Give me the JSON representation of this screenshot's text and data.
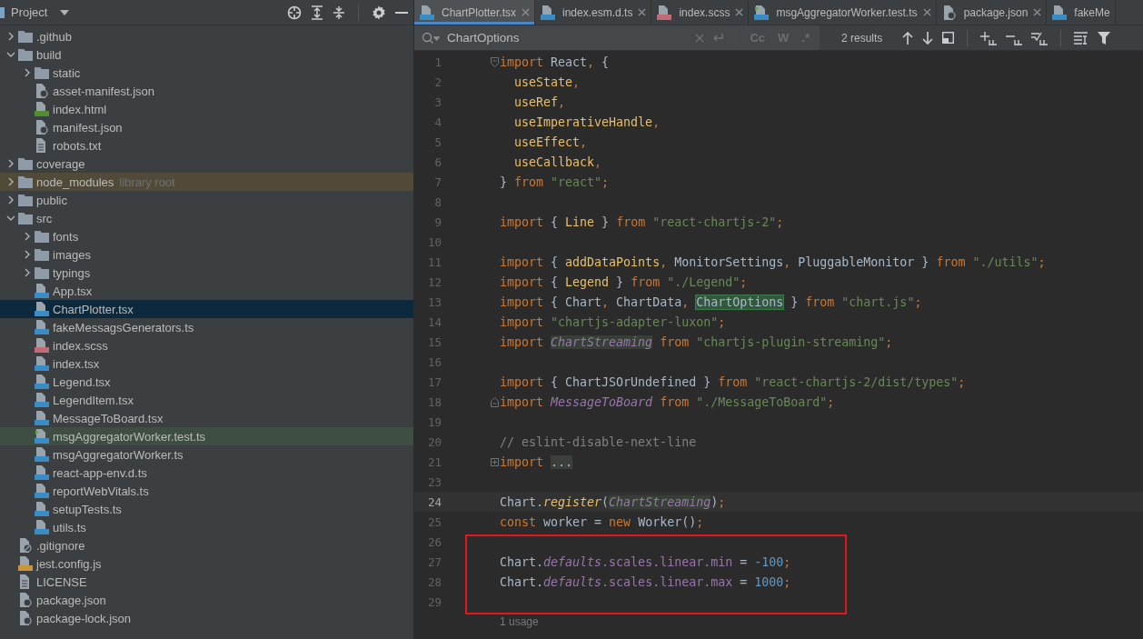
{
  "project_panel": {
    "title": "Project",
    "tree": [
      {
        "kind": "folder",
        "name": ".github",
        "expanded": false,
        "selected": false,
        "highlighted": false
      },
      {
        "kind": "folder",
        "name": "build",
        "expanded": true,
        "selected": false,
        "highlighted": false,
        "children": [
          {
            "kind": "folder",
            "name": "static",
            "expanded": false,
            "selected": false,
            "highlighted": false
          },
          {
            "kind": "json",
            "name": "asset-manifest.json",
            "selected": false,
            "highlighted": false
          },
          {
            "kind": "html",
            "name": "index.html",
            "selected": false,
            "highlighted": false
          },
          {
            "kind": "json",
            "name": "manifest.json",
            "selected": false,
            "highlighted": false
          },
          {
            "kind": "text",
            "name": "robots.txt",
            "selected": false,
            "highlighted": false
          }
        ]
      },
      {
        "kind": "folder",
        "name": "coverage",
        "expanded": false,
        "selected": false,
        "highlighted": false
      },
      {
        "kind": "folder",
        "name": "node_modules",
        "note": "library root",
        "expanded": false,
        "selected": false,
        "highlighted": false
      },
      {
        "kind": "folder",
        "name": "public",
        "expanded": false,
        "selected": false,
        "highlighted": false
      },
      {
        "kind": "folder",
        "name": "src",
        "expanded": true,
        "selected": false,
        "highlighted": false,
        "children": [
          {
            "kind": "folder",
            "name": "fonts",
            "expanded": false,
            "selected": false,
            "highlighted": false
          },
          {
            "kind": "folder",
            "name": "images",
            "expanded": false,
            "selected": false,
            "highlighted": false
          },
          {
            "kind": "folder",
            "name": "typings",
            "expanded": false,
            "selected": false,
            "highlighted": false
          },
          {
            "kind": "tsx",
            "name": "App.tsx",
            "selected": false,
            "highlighted": false
          },
          {
            "kind": "tsx",
            "name": "ChartPlotter.tsx",
            "selected": true,
            "highlighted": false
          },
          {
            "kind": "ts",
            "name": "fakeMessagsGenerators.ts",
            "selected": false,
            "highlighted": false
          },
          {
            "kind": "sass",
            "name": "index.scss",
            "selected": false,
            "highlighted": false
          },
          {
            "kind": "tsx",
            "name": "index.tsx",
            "selected": false,
            "highlighted": false
          },
          {
            "kind": "tsx",
            "name": "Legend.tsx",
            "selected": false,
            "highlighted": false
          },
          {
            "kind": "tsx",
            "name": "LegendItem.tsx",
            "selected": false,
            "highlighted": false
          },
          {
            "kind": "tsx",
            "name": "MessageToBoard.tsx",
            "selected": false,
            "highlighted": false
          },
          {
            "kind": "test",
            "name": "msgAggregatorWorker.test.ts",
            "selected": false,
            "highlighted": true
          },
          {
            "kind": "ts",
            "name": "msgAggregatorWorker.ts",
            "selected": false,
            "highlighted": false
          },
          {
            "kind": "ts",
            "name": "react-app-env.d.ts",
            "selected": false,
            "highlighted": false
          },
          {
            "kind": "ts",
            "name": "reportWebVitals.ts",
            "selected": false,
            "highlighted": false
          },
          {
            "kind": "ts",
            "name": "setupTests.ts",
            "selected": false,
            "highlighted": false
          },
          {
            "kind": "ts",
            "name": "utils.ts",
            "selected": false,
            "highlighted": false
          }
        ]
      },
      {
        "kind": "ignore",
        "name": ".gitignore",
        "selected": false,
        "highlighted": false
      },
      {
        "kind": "js",
        "name": "jest.config.js",
        "selected": false,
        "highlighted": false
      },
      {
        "kind": "text",
        "name": "LICENSE",
        "selected": false,
        "highlighted": false
      },
      {
        "kind": "json",
        "name": "package.json",
        "selected": false,
        "highlighted": false
      },
      {
        "kind": "json",
        "name": "package-lock.json",
        "selected": false,
        "highlighted": false
      }
    ]
  },
  "editor": {
    "tabs": [
      {
        "label": "ChartPlotter.tsx",
        "kind": "tsx",
        "selected": true,
        "closable": true
      },
      {
        "label": "index.esm.d.ts",
        "kind": "ts",
        "selected": false,
        "closable": true
      },
      {
        "label": "index.scss",
        "kind": "sass",
        "selected": false,
        "closable": true
      },
      {
        "label": "msgAggregatorWorker.test.ts",
        "kind": "test",
        "selected": false,
        "closable": true
      },
      {
        "label": "package.json",
        "kind": "json",
        "selected": false,
        "closable": true
      },
      {
        "label": "fakeMe",
        "kind": "ts",
        "selected": false,
        "closable": false
      }
    ],
    "search": {
      "value": "ChartOptions",
      "options": [
        "Cc",
        "W",
        ".*"
      ],
      "result_count": "2 results"
    },
    "lines": [
      {
        "number": "1",
        "kind": "fold-start",
        "current": false,
        "boxed": false,
        "tokens": [
          {
            "kind": "kw",
            "text": "import "
          },
          {
            "kind": "plain",
            "text": "React"
          },
          {
            "kind": "kw",
            "text": ", "
          },
          {
            "kind": "plain",
            "text": "{"
          }
        ]
      },
      {
        "number": "2",
        "current": false,
        "boxed": false,
        "tokens": [
          {
            "kind": "fn",
            "text": "  useState"
          },
          {
            "kind": "kw",
            "text": ","
          }
        ]
      },
      {
        "number": "3",
        "current": false,
        "boxed": false,
        "tokens": [
          {
            "kind": "fn",
            "text": "  useRef"
          },
          {
            "kind": "kw",
            "text": ","
          }
        ]
      },
      {
        "number": "4",
        "current": false,
        "boxed": false,
        "tokens": [
          {
            "kind": "fn",
            "text": "  useImperativeHandle"
          },
          {
            "kind": "kw",
            "text": ","
          }
        ]
      },
      {
        "number": "5",
        "current": false,
        "boxed": false,
        "tokens": [
          {
            "kind": "fn",
            "text": "  useEffect"
          },
          {
            "kind": "kw",
            "text": ","
          }
        ]
      },
      {
        "number": "6",
        "current": false,
        "boxed": false,
        "tokens": [
          {
            "kind": "fn",
            "text": "  useCallback"
          },
          {
            "kind": "kw",
            "text": ","
          }
        ]
      },
      {
        "number": "7",
        "current": false,
        "boxed": false,
        "tokens": [
          {
            "kind": "plain",
            "text": "} "
          },
          {
            "kind": "kw",
            "text": "from "
          },
          {
            "kind": "str",
            "text": "\"react\""
          },
          {
            "kind": "kw",
            "text": ";"
          }
        ]
      },
      {
        "number": "8",
        "current": false,
        "boxed": false
      },
      {
        "number": "9",
        "current": false,
        "boxed": false,
        "tokens": [
          {
            "kind": "kw",
            "text": "import "
          },
          {
            "kind": "plain",
            "text": "{ "
          },
          {
            "kind": "fn",
            "text": "Line"
          },
          {
            "kind": "plain",
            "text": " } "
          },
          {
            "kind": "kw",
            "text": "from "
          },
          {
            "kind": "str",
            "text": "\"react-chartjs-2\""
          },
          {
            "kind": "kw",
            "text": ";"
          }
        ]
      },
      {
        "number": "10",
        "current": false,
        "boxed": false
      },
      {
        "number": "11",
        "current": false,
        "boxed": false,
        "tokens": [
          {
            "kind": "kw",
            "text": "import "
          },
          {
            "kind": "plain",
            "text": "{ "
          },
          {
            "kind": "fn",
            "text": "addDataPoints"
          },
          {
            "kind": "kw",
            "text": ", "
          },
          {
            "kind": "plain",
            "text": "MonitorSettings"
          },
          {
            "kind": "kw",
            "text": ", "
          },
          {
            "kind": "plain",
            "text": "PluggableMonitor } "
          },
          {
            "kind": "kw",
            "text": "from "
          },
          {
            "kind": "str",
            "text": "\"./utils\""
          },
          {
            "kind": "kw",
            "text": ";"
          }
        ]
      },
      {
        "number": "12",
        "current": false,
        "boxed": false,
        "tokens": [
          {
            "kind": "kw",
            "text": "import "
          },
          {
            "kind": "plain",
            "text": "{ "
          },
          {
            "kind": "fn",
            "text": "Legend"
          },
          {
            "kind": "plain",
            "text": " } "
          },
          {
            "kind": "kw",
            "text": "from "
          },
          {
            "kind": "str",
            "text": "\"./Legend\""
          },
          {
            "kind": "kw",
            "text": ";"
          }
        ]
      },
      {
        "number": "13",
        "current": false,
        "boxed": false,
        "tokens": [
          {
            "kind": "kw",
            "text": "import "
          },
          {
            "kind": "plain",
            "text": "{ Chart"
          },
          {
            "kind": "kw",
            "text": ", "
          },
          {
            "kind": "plain",
            "text": "ChartData"
          },
          {
            "kind": "kw",
            "text": ", "
          },
          {
            "kind": "match",
            "text": "ChartOptions"
          },
          {
            "kind": "plain",
            "text": " } "
          },
          {
            "kind": "kw",
            "text": "from "
          },
          {
            "kind": "str",
            "text": "\"chart.js\""
          },
          {
            "kind": "kw",
            "text": ";"
          }
        ]
      },
      {
        "number": "14",
        "current": false,
        "boxed": false,
        "tokens": [
          {
            "kind": "kw",
            "text": "import "
          },
          {
            "kind": "str",
            "text": "\"chartjs-adapter-luxon\""
          },
          {
            "kind": "kw",
            "text": ";"
          }
        ]
      },
      {
        "number": "15",
        "current": false,
        "boxed": false,
        "tokens": [
          {
            "kind": "kw",
            "text": "import "
          },
          {
            "kind": "usage",
            "text": "ChartStreaming"
          },
          {
            "kind": "kw",
            "text": " from "
          },
          {
            "kind": "str",
            "text": "\"chartjs-plugin-streaming\""
          },
          {
            "kind": "kw",
            "text": ";"
          }
        ]
      },
      {
        "number": "16",
        "current": false,
        "boxed": false
      },
      {
        "number": "17",
        "current": false,
        "boxed": false,
        "tokens": [
          {
            "kind": "kw",
            "text": "import "
          },
          {
            "kind": "plain",
            "text": "{ ChartJSOrUndefined } "
          },
          {
            "kind": "kw",
            "text": "from "
          },
          {
            "kind": "str",
            "text": "\"react-chartjs-2/dist/types\""
          },
          {
            "kind": "kw",
            "text": ";"
          }
        ]
      },
      {
        "number": "18",
        "kind": "fold-end",
        "current": false,
        "boxed": false,
        "tokens": [
          {
            "kind": "kw",
            "text": "import "
          },
          {
            "kind": "purple",
            "text": "MessageToBoard"
          },
          {
            "kind": "kw",
            "text": " from "
          },
          {
            "kind": "str",
            "text": "\"./MessageToBoard\""
          },
          {
            "kind": "kw",
            "text": ";"
          }
        ]
      },
      {
        "number": "19",
        "current": false,
        "boxed": false
      },
      {
        "number": "20",
        "current": false,
        "boxed": false,
        "tokens": [
          {
            "kind": "comment",
            "text": "// eslint-disable-next-line"
          }
        ]
      },
      {
        "number": "21",
        "kind": "folded",
        "current": false,
        "boxed": false,
        "tokens": [
          {
            "kind": "kw",
            "text": "import "
          },
          {
            "kind": "folded",
            "text": "..."
          }
        ]
      },
      {
        "number": "23",
        "current": false,
        "boxed": false
      },
      {
        "number": "24",
        "current": true,
        "boxed": false,
        "tokens": [
          {
            "kind": "plain",
            "text": "Chart."
          },
          {
            "kind": "fn-italic",
            "text": "register"
          },
          {
            "kind": "plain",
            "text": "("
          },
          {
            "kind": "usage",
            "text": "ChartStreaming"
          },
          {
            "kind": "plain",
            "text": ")"
          },
          {
            "kind": "kw",
            "text": ";"
          }
        ]
      },
      {
        "number": "25",
        "current": false,
        "boxed": false,
        "tokens": [
          {
            "kind": "kw",
            "text": "const "
          },
          {
            "kind": "plain",
            "text": "worker = "
          },
          {
            "kind": "kw",
            "text": "new "
          },
          {
            "kind": "plain",
            "text": "Worker()"
          },
          {
            "kind": "kw",
            "text": ";"
          }
        ]
      },
      {
        "number": "26",
        "current": false,
        "boxed": true
      },
      {
        "number": "27",
        "current": false,
        "boxed": true,
        "tokens": [
          {
            "kind": "plain",
            "text": "Chart."
          },
          {
            "kind": "purple",
            "text": "defaults"
          },
          {
            "kind": "prop",
            "text": ".scales.linear.min"
          },
          {
            "kind": "plain",
            "text": " = "
          },
          {
            "kind": "num",
            "text": "-100"
          },
          {
            "kind": "kw",
            "text": ";"
          }
        ]
      },
      {
        "number": "28",
        "current": false,
        "boxed": true,
        "tokens": [
          {
            "kind": "plain",
            "text": "Chart."
          },
          {
            "kind": "purple",
            "text": "defaults"
          },
          {
            "kind": "prop",
            "text": ".scales.linear.max"
          },
          {
            "kind": "plain",
            "text": " = "
          },
          {
            "kind": "num",
            "text": "1000"
          },
          {
            "kind": "kw",
            "text": ";"
          }
        ]
      },
      {
        "number": "29",
        "current": false,
        "boxed": true
      }
    ],
    "hint": "1 usage"
  }
}
